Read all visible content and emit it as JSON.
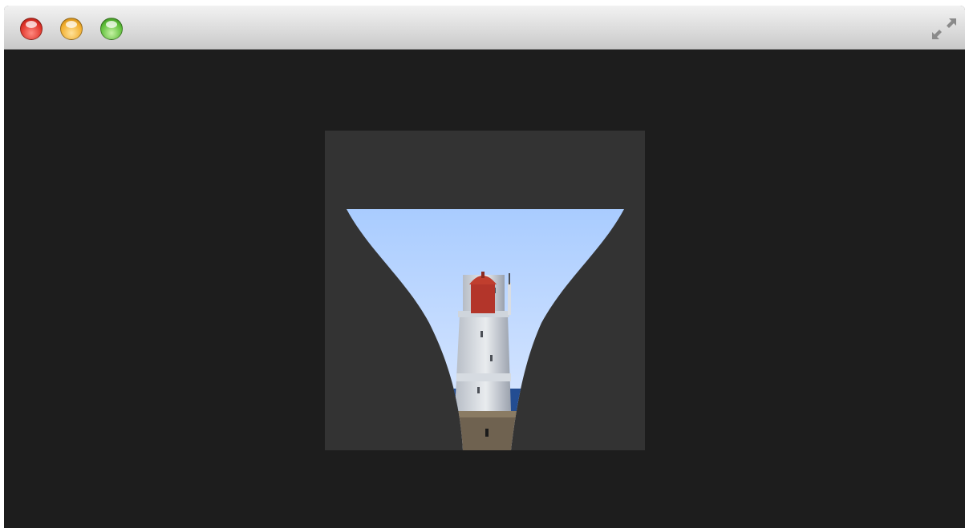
{
  "window": {
    "controls": {
      "close": "close",
      "minimize": "minimize",
      "zoom": "zoom",
      "fullscreen_icon": "fullscreen-icon"
    }
  },
  "canvas": {
    "background": "#1d1d1d",
    "panel_color": "#333333",
    "image": "lighthouse",
    "effect": "genie"
  }
}
